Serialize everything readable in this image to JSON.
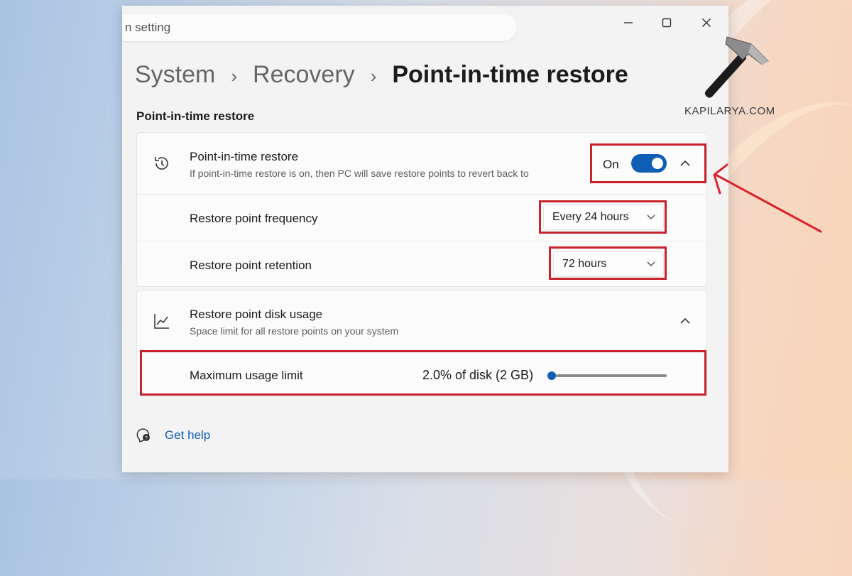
{
  "search": {
    "value": "n setting"
  },
  "window_controls": {
    "minimize": "minimize",
    "maximize": "maximize",
    "close": "close"
  },
  "breadcrumb": [
    "System",
    "Recovery",
    "Point-in-time restore"
  ],
  "breadcrumb_separator": "›",
  "section_title": "Point-in-time restore",
  "restore_card": {
    "title": "Point-in-time restore",
    "description": "If point-in-time restore is on, then PC will save restore points to revert back to",
    "toggle_state": "On",
    "frequency_label": "Restore point frequency",
    "frequency_value": "Every 24 hours",
    "retention_label": "Restore point retention",
    "retention_value": "72 hours"
  },
  "disk_card": {
    "title": "Restore point disk usage",
    "description": "Space limit for all restore points on your system",
    "limit_label": "Maximum usage limit",
    "limit_value": "2.0% of disk (2 GB)",
    "slider_fraction": 0.0
  },
  "help": {
    "label": "Get help"
  },
  "watermark": {
    "text": "KAPILARYA.COM"
  },
  "colors": {
    "accent": "#0f5fb5",
    "highlight": "#c8222c"
  }
}
